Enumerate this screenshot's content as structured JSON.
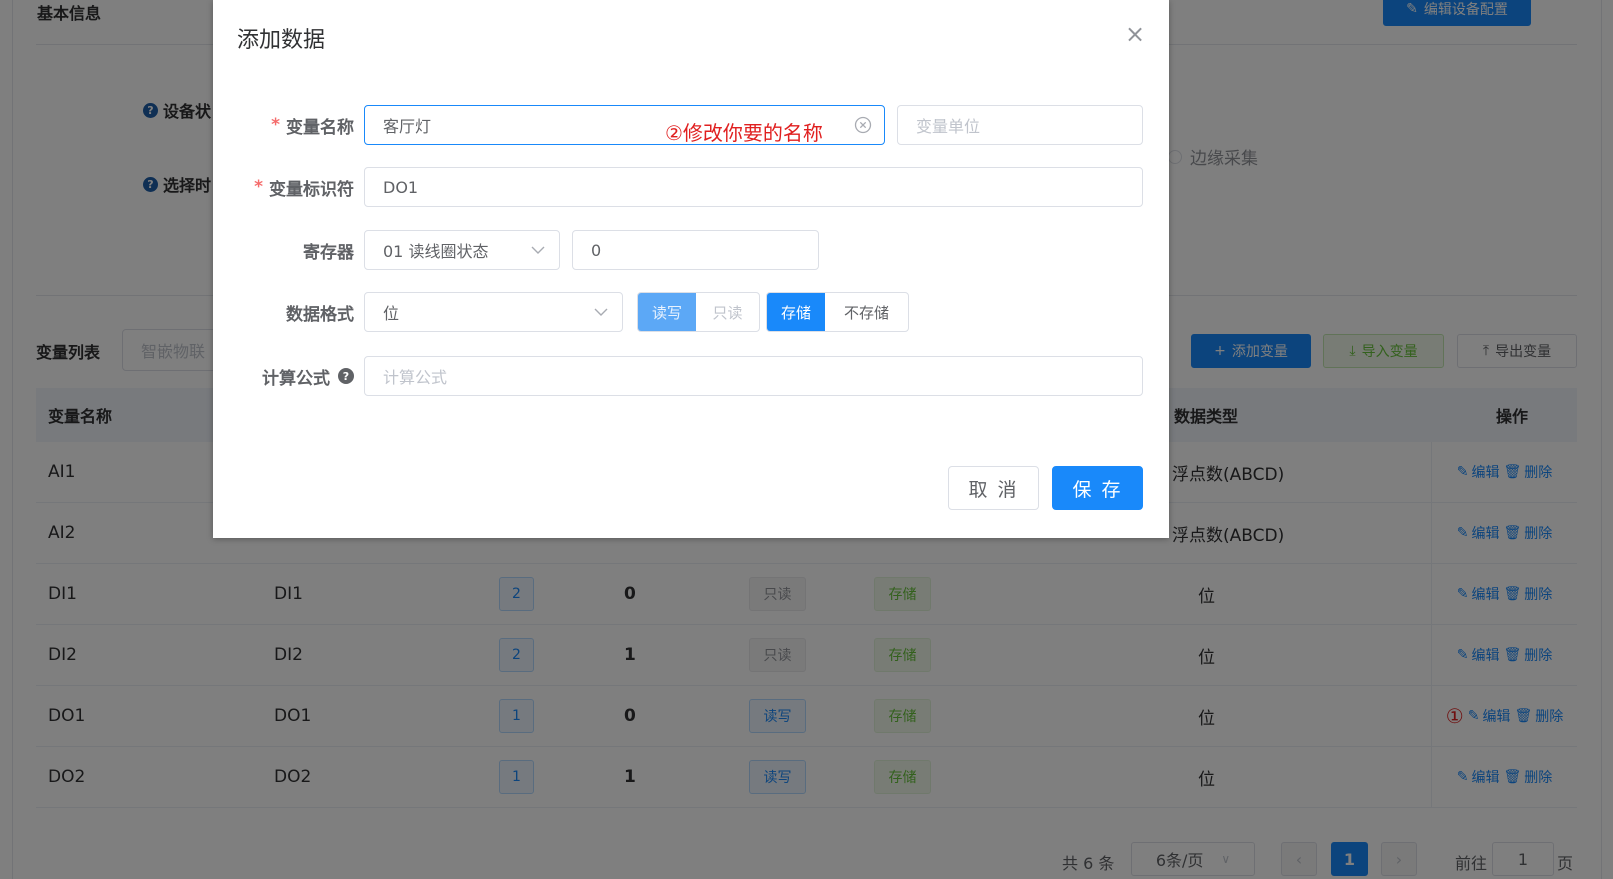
{
  "background": {
    "section_basic": "基本信息",
    "edit_config_button": "编辑设备配置",
    "field_device_status": "设备状",
    "field_select_time": "选择时",
    "radio_edge": "边缘采集",
    "section_variables": "变量列表",
    "search_placeholder": "智嵌物联",
    "add_variable": "添加变量",
    "import_variable": "导入变量",
    "export_variable": "导出变量",
    "columns": {
      "name": "变量名称",
      "data_type": "数据类型",
      "ops": "操作"
    },
    "rows": [
      {
        "name": "AI1",
        "id": "",
        "reg": "",
        "addr": "",
        "rw": "",
        "store": "",
        "type": "浮点数(ABCD)"
      },
      {
        "name": "AI2",
        "id": "",
        "reg": "",
        "addr": "",
        "rw": "",
        "store": "",
        "type": "浮点数(ABCD)"
      },
      {
        "name": "DI1",
        "id": "DI1",
        "reg": "2",
        "addr": "0",
        "rw": "只读",
        "store": "存储",
        "type": "位"
      },
      {
        "name": "DI2",
        "id": "DI2",
        "reg": "2",
        "addr": "1",
        "rw": "只读",
        "store": "存储",
        "type": "位"
      },
      {
        "name": "DO1",
        "id": "DO1",
        "reg": "1",
        "addr": "0",
        "rw": "读写",
        "store": "存储",
        "type": "位"
      },
      {
        "name": "DO2",
        "id": "DO2",
        "reg": "1",
        "addr": "1",
        "rw": "读写",
        "store": "存储",
        "type": "位"
      }
    ],
    "op_edit": "编辑",
    "op_delete": "删除",
    "annotation_1": "①",
    "pagination": {
      "total": "共 6 条",
      "page_size": "6条/页",
      "current_page": "1",
      "goto_prefix": "前往",
      "goto_value": "1",
      "goto_suffix": "页"
    }
  },
  "dialog": {
    "title": "添加数据",
    "close_icon": "×",
    "label_var_name": "变量名称",
    "var_name_value": "客厅灯",
    "annotation_2": "②修改你要的名称",
    "var_unit_placeholder": "变量单位",
    "label_var_id": "变量标识符",
    "var_id_value": "DO1",
    "label_register": "寄存器",
    "register_value": "01 读线圈状态",
    "register_addr": "0",
    "label_format": "数据格式",
    "format_value": "位",
    "rw_options": [
      "读写",
      "只读"
    ],
    "store_options": [
      "存储",
      "不存储"
    ],
    "label_formula": "计算公式",
    "formula_placeholder": "计算公式",
    "cancel": "取 消",
    "save": "保 存"
  },
  "colors": {
    "primary": "#1989fa",
    "danger": "#f56c6c",
    "annotation": "#e02020"
  }
}
